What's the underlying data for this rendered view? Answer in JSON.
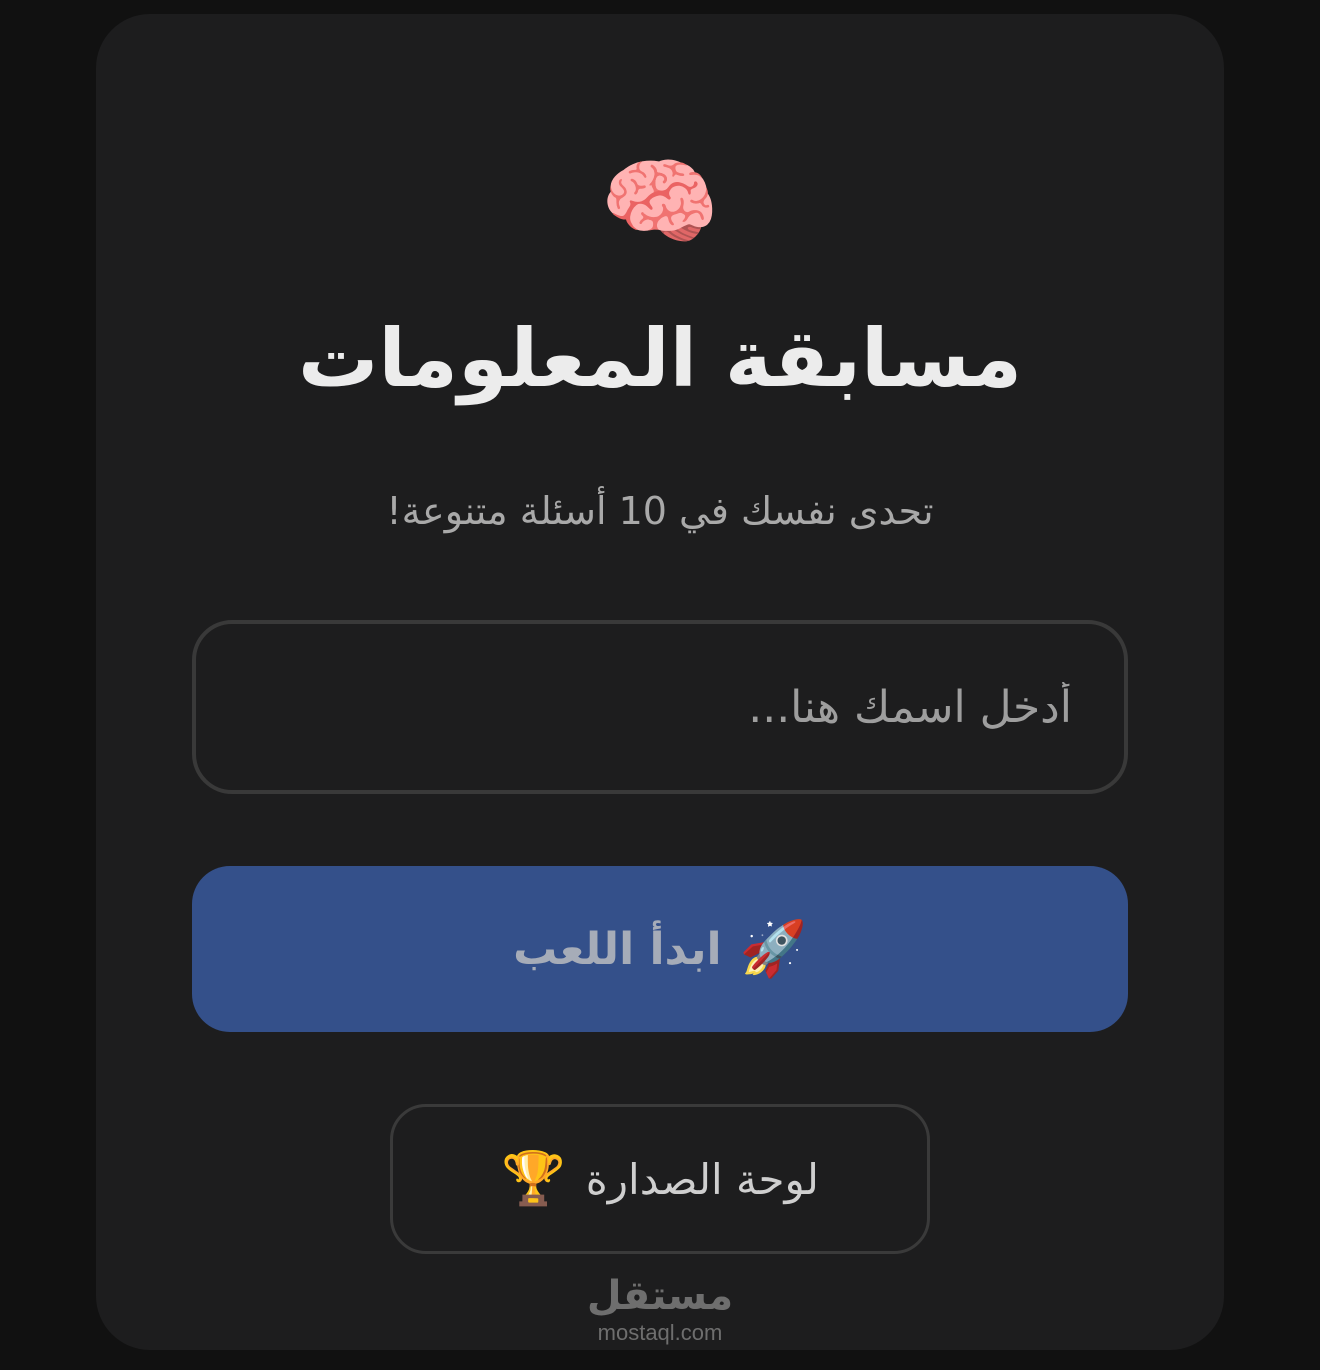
{
  "header": {
    "icon": "brain-icon",
    "icon_glyph": "🧠",
    "title": "مسابقة المعلومات",
    "subtitle": "تحدى نفسك في 10 أسئلة متنوعة!"
  },
  "form": {
    "name_placeholder": "أدخل اسمك هنا...",
    "name_value": ""
  },
  "actions": {
    "start_label": "ابدأ اللعب",
    "start_icon": "rocket-icon",
    "start_icon_glyph": "🚀",
    "leaderboard_label": "لوحة الصدارة",
    "leaderboard_icon": "trophy-icon",
    "leaderboard_icon_glyph": "🏆"
  },
  "watermark": {
    "arabic": "مستقل",
    "latin": "mostaql.com"
  },
  "colors": {
    "background": "#111111",
    "card": "#1d1d1e",
    "primary_button": "#34508a",
    "title_text": "#ececec"
  }
}
